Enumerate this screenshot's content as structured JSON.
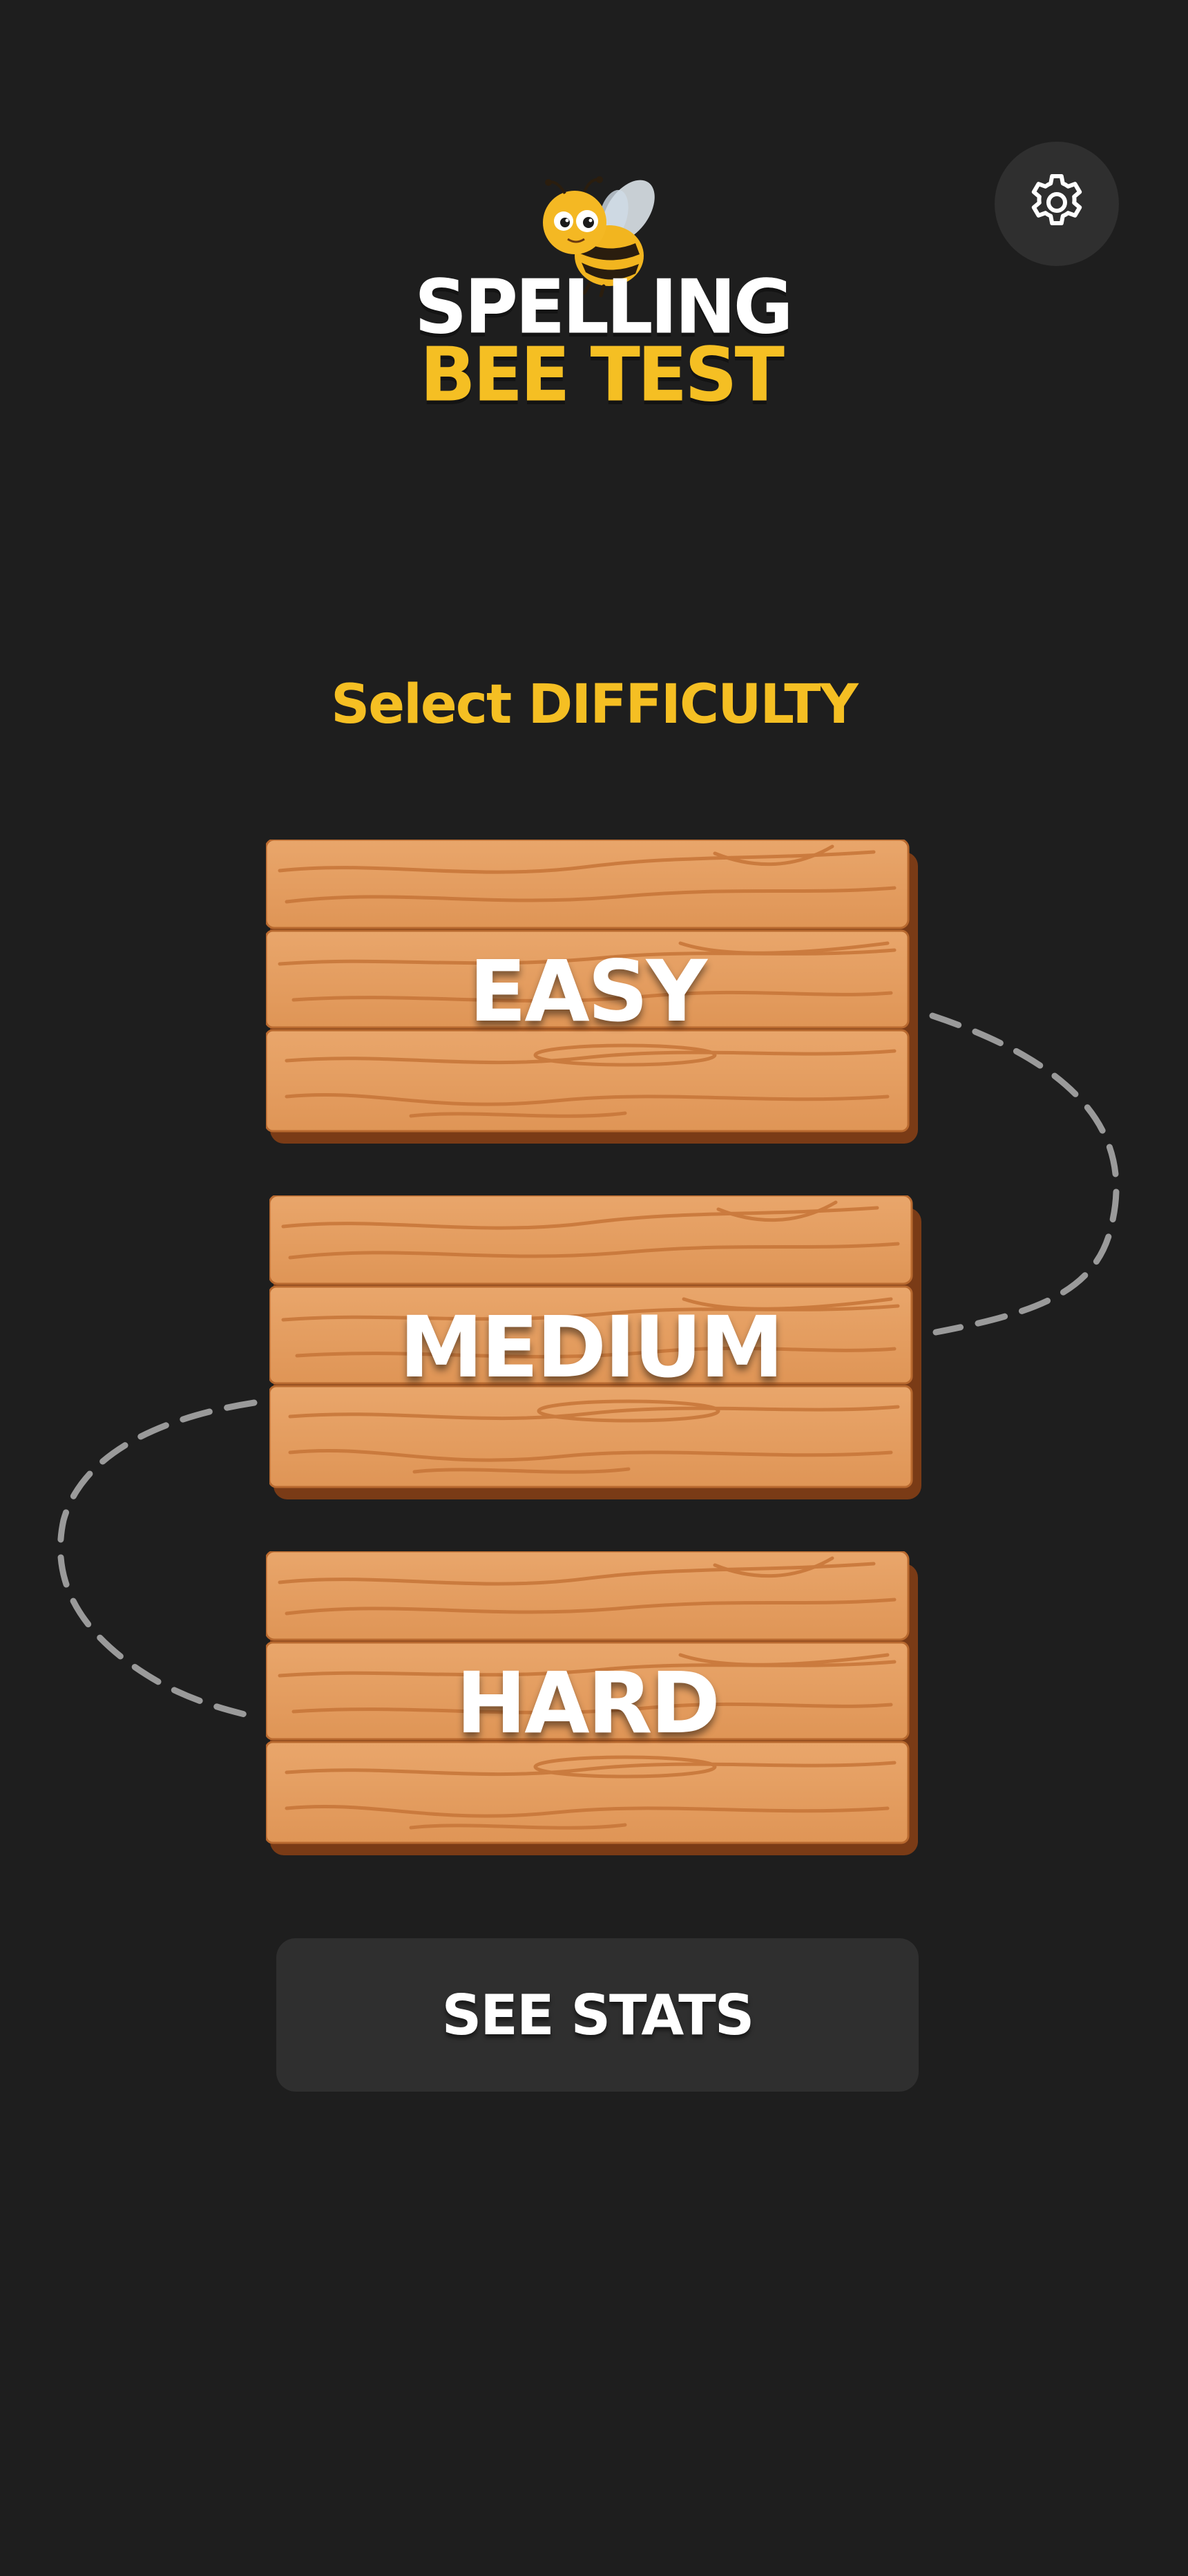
{
  "app": {
    "title_line1": "SPELLING",
    "title_line2": "BEE TEST",
    "mascot": "bee-mascot"
  },
  "settings": {
    "icon": "gear-icon"
  },
  "difficulty": {
    "heading": "Select DIFFICULTY",
    "options": [
      {
        "label": "EASY"
      },
      {
        "label": "MEDIUM"
      },
      {
        "label": "HARD"
      }
    ]
  },
  "stats": {
    "label": "SEE STATS"
  },
  "colors": {
    "background": "#1e1e1e",
    "accent_yellow": "#f5bf23",
    "wood": "#e29a5c",
    "wood_dark": "#7a3b16",
    "button_dark": "#2f2f2f"
  }
}
